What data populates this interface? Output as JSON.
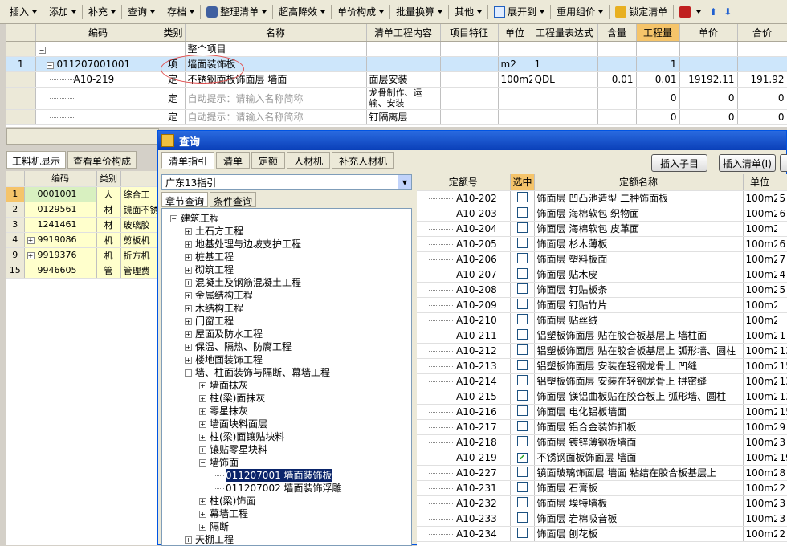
{
  "toolbar": {
    "items": [
      "插入",
      "添加",
      "补充",
      "查询",
      "存档",
      "整理清单",
      "超高降效",
      "单价构成",
      "批量换算",
      "其他",
      "展开到",
      "重用组价",
      "锁定清单"
    ]
  },
  "grid": {
    "headers": [
      "编码",
      "类别",
      "名称",
      "清单工程内容",
      "项目特征",
      "单位",
      "工程量表达式",
      "含量",
      "工程量",
      "单价",
      "合价"
    ],
    "section": "整个项目",
    "rows": [
      {
        "n": "1",
        "code": "011207001001",
        "type": "项",
        "name": "墙面装饰板",
        "content": "",
        "feature": "",
        "unit": "m2",
        "expr": "1",
        "qty_rate": "",
        "qty": "1",
        "price": "",
        "total": ""
      },
      {
        "n": "",
        "code": "A10-219",
        "type": "定",
        "name": "不锈钢面板饰面层 墙面",
        "content": "面层安装",
        "feature": "",
        "unit": "100m2",
        "expr": "QDL",
        "qty_rate": "0.01",
        "qty": "0.01",
        "price": "19192.11",
        "total": "191.92"
      },
      {
        "n": "",
        "code": "",
        "type": "定",
        "name": "自动提示：请输入名称简称",
        "content": "龙骨制作、运输、安装",
        "feature": "",
        "unit": "",
        "expr": "",
        "qty_rate": "",
        "qty": "0",
        "price": "0",
        "total": "0"
      },
      {
        "n": "",
        "code": "",
        "type": "定",
        "name": "自动提示：请输入名称简称",
        "content": "钉隔离层",
        "feature": "",
        "unit": "",
        "expr": "",
        "qty_rate": "",
        "qty": "0",
        "price": "0",
        "total": "0"
      }
    ]
  },
  "left_tabs": [
    "工料机显示",
    "查看单价构成"
  ],
  "left_grid": {
    "headers": [
      "编码",
      "类别"
    ],
    "rows": [
      {
        "n": "1",
        "code": "0001001",
        "type": "人",
        "name": "综合工"
      },
      {
        "n": "2",
        "code": "0129561",
        "type": "材",
        "name": "镜面不锈"
      },
      {
        "n": "3",
        "code": "1241461",
        "type": "材",
        "name": "玻璃胶"
      },
      {
        "n": "4",
        "code": "9919086",
        "type": "机",
        "name": "剪板机"
      },
      {
        "n": "9",
        "code": "9919376",
        "type": "机",
        "name": "折方机"
      },
      {
        "n": "15",
        "code": "9946605",
        "type": "管",
        "name": "管理费"
      }
    ]
  },
  "dialog": {
    "title": "查询",
    "tabs": [
      "清单指引",
      "清单",
      "定额",
      "人材机",
      "补充人材机"
    ],
    "btn_insert_child": "插入子目",
    "btn_insert_list": "插入清单(I)",
    "combo_value": "广东13指引",
    "subtabs": [
      "章节查询",
      "条件查询"
    ],
    "tree": [
      {
        "l": 0,
        "t": "建筑工程",
        "pm": "-"
      },
      {
        "l": 1,
        "t": "土石方工程",
        "pm": "+"
      },
      {
        "l": 1,
        "t": "地基处理与边坡支护工程",
        "pm": "+"
      },
      {
        "l": 1,
        "t": "桩基工程",
        "pm": "+"
      },
      {
        "l": 1,
        "t": "砌筑工程",
        "pm": "+"
      },
      {
        "l": 1,
        "t": "混凝土及钢筋混凝土工程",
        "pm": "+"
      },
      {
        "l": 1,
        "t": "金属结构工程",
        "pm": "+"
      },
      {
        "l": 1,
        "t": "木结构工程",
        "pm": "+"
      },
      {
        "l": 1,
        "t": "门窗工程",
        "pm": "+"
      },
      {
        "l": 1,
        "t": "屋面及防水工程",
        "pm": "+"
      },
      {
        "l": 1,
        "t": "保温、隔热、防腐工程",
        "pm": "+"
      },
      {
        "l": 1,
        "t": "楼地面装饰工程",
        "pm": "+"
      },
      {
        "l": 1,
        "t": "墙、柱面装饰与隔断、幕墙工程",
        "pm": "-"
      },
      {
        "l": 2,
        "t": "墙面抹灰",
        "pm": "+"
      },
      {
        "l": 2,
        "t": "柱(梁)面抹灰",
        "pm": "+"
      },
      {
        "l": 2,
        "t": "零星抹灰",
        "pm": "+"
      },
      {
        "l": 2,
        "t": "墙面块料面层",
        "pm": "+"
      },
      {
        "l": 2,
        "t": "柱(梁)面镶贴块料",
        "pm": "+"
      },
      {
        "l": 2,
        "t": "镶贴零星块料",
        "pm": "+"
      },
      {
        "l": 2,
        "t": "墙饰面",
        "pm": "-"
      },
      {
        "l": 3,
        "t": "011207001   墙面装饰板",
        "pm": "",
        "sel": true
      },
      {
        "l": 3,
        "t": "011207002   墙面装饰浮雕",
        "pm": ""
      },
      {
        "l": 2,
        "t": "柱(梁)饰面",
        "pm": "+"
      },
      {
        "l": 2,
        "t": "幕墙工程",
        "pm": "+"
      },
      {
        "l": 2,
        "t": "隔断",
        "pm": "+"
      },
      {
        "l": 1,
        "t": "天棚工程",
        "pm": "+"
      }
    ],
    "right_headers": [
      "定额号",
      "选中",
      "定额名称",
      "单位"
    ],
    "right_rows": [
      {
        "code": "A10-202",
        "chk": false,
        "name": "饰面层 凹凸池造型 二种饰面板",
        "unit": "100m2",
        "x": "5"
      },
      {
        "code": "A10-203",
        "chk": false,
        "name": "饰面层 海棉软包 织物面",
        "unit": "100m2",
        "x": "6"
      },
      {
        "code": "A10-204",
        "chk": false,
        "name": "饰面层 海棉软包 皮革面",
        "unit": "100m2",
        "x": ""
      },
      {
        "code": "A10-205",
        "chk": false,
        "name": "饰面层 杉木薄板",
        "unit": "100m2",
        "x": "6"
      },
      {
        "code": "A10-206",
        "chk": false,
        "name": "饰面层 塑料板面",
        "unit": "100m2",
        "x": "7"
      },
      {
        "code": "A10-207",
        "chk": false,
        "name": "饰面层 贴木皮",
        "unit": "100m2",
        "x": "4"
      },
      {
        "code": "A10-208",
        "chk": false,
        "name": "饰面层 钉贴板条",
        "unit": "100m2",
        "x": "5"
      },
      {
        "code": "A10-209",
        "chk": false,
        "name": "饰面层 钉贴竹片",
        "unit": "100m2",
        "x": ""
      },
      {
        "code": "A10-210",
        "chk": false,
        "name": "饰面层 贴丝绒",
        "unit": "100m2",
        "x": ""
      },
      {
        "code": "A10-211",
        "chk": false,
        "name": "铝塑板饰面层 贴在胶合板基层上 墙柱面",
        "unit": "100m2",
        "x": "1"
      },
      {
        "code": "A10-212",
        "chk": false,
        "name": "铝塑板饰面层 贴在胶合板基层上 弧形墙、圆柱",
        "unit": "100m2",
        "x": "13"
      },
      {
        "code": "A10-213",
        "chk": false,
        "name": "铝塑板饰面层 安装在轻钢龙骨上 凹缝",
        "unit": "100m2",
        "x": "15"
      },
      {
        "code": "A10-214",
        "chk": false,
        "name": "铝塑板饰面层 安装在轻钢龙骨上 拼密缝",
        "unit": "100m2",
        "x": "13"
      },
      {
        "code": "A10-215",
        "chk": false,
        "name": "饰面层 镁铝曲板贴在胶合板上 弧形墙、圆柱",
        "unit": "100m2",
        "x": "13"
      },
      {
        "code": "A10-216",
        "chk": false,
        "name": "饰面层 电化铝板墙面",
        "unit": "100m2",
        "x": "15"
      },
      {
        "code": "A10-217",
        "chk": false,
        "name": "饰面层 铝合金装饰扣板",
        "unit": "100m2",
        "x": "9"
      },
      {
        "code": "A10-218",
        "chk": false,
        "name": "饰面层 镀锌薄钢板墙面",
        "unit": "100m2",
        "x": "3"
      },
      {
        "code": "A10-219",
        "chk": true,
        "name": "不锈钢面板饰面层 墙面",
        "unit": "100m2",
        "x": "19"
      },
      {
        "code": "A10-227",
        "chk": false,
        "name": "镜面玻璃饰面层 墙面 粘结在胶合板基层上",
        "unit": "100m2",
        "x": "8"
      },
      {
        "code": "A10-231",
        "chk": false,
        "name": "饰面层 石膏板",
        "unit": "100m2",
        "x": "2"
      },
      {
        "code": "A10-232",
        "chk": false,
        "name": "饰面层 埃特墙板",
        "unit": "100m2",
        "x": "3"
      },
      {
        "code": "A10-233",
        "chk": false,
        "name": "饰面层 岩棉吸音板",
        "unit": "100m2",
        "x": "3"
      },
      {
        "code": "A10-234",
        "chk": false,
        "name": "饰面层 刨花板",
        "unit": "100m2",
        "x": "2"
      }
    ]
  }
}
